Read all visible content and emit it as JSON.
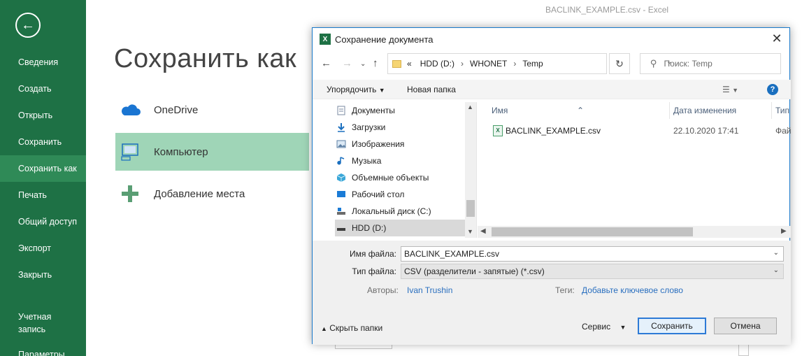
{
  "window": {
    "title": "BACLINK_EXAMPLE.csv  -  Excel"
  },
  "sidebar": {
    "back_icon": "back-arrow-icon",
    "items": [
      {
        "label": "Сведения"
      },
      {
        "label": "Создать"
      },
      {
        "label": "Открыть"
      },
      {
        "label": "Сохранить"
      },
      {
        "label": "Сохранить как",
        "active": true
      },
      {
        "label": "Печать"
      },
      {
        "label": "Общий доступ"
      },
      {
        "label": "Экспорт"
      },
      {
        "label": "Закрыть"
      },
      {
        "label": "Учетная запись"
      },
      {
        "label": "Параметры"
      }
    ],
    "bg_color": "#1e7145"
  },
  "main": {
    "title": "Сохранить как",
    "locations": [
      {
        "label": "OneDrive",
        "icon": "cloud-icon"
      },
      {
        "label": "Компьютер",
        "icon": "computer-icon",
        "selected": true
      },
      {
        "label": "Добавление места",
        "icon": "plus-icon"
      }
    ]
  },
  "dialog": {
    "title": "Сохранение документа",
    "breadcrumb": {
      "prefix": "«",
      "parts": [
        "HDD (D:)",
        "WHONET",
        "Temp"
      ]
    },
    "search_placeholder": "Поиск: Temp",
    "toolbar": {
      "organize": "Упорядочить",
      "new_folder": "Новая папка"
    },
    "tree": [
      {
        "label": "Документы",
        "icon": "documents-icon"
      },
      {
        "label": "Загрузки",
        "icon": "downloads-icon"
      },
      {
        "label": "Изображения",
        "icon": "pictures-icon"
      },
      {
        "label": "Музыка",
        "icon": "music-icon"
      },
      {
        "label": "Объемные объекты",
        "icon": "3d-objects-icon"
      },
      {
        "label": "Рабочий стол",
        "icon": "desktop-icon"
      },
      {
        "label": "Локальный диск (C:)",
        "icon": "drive-icon"
      },
      {
        "label": "HDD (D:)",
        "icon": "drive-icon",
        "selected": true
      }
    ],
    "columns": {
      "name": "Имя",
      "date": "Дата изменения",
      "type": "Тип"
    },
    "files": [
      {
        "name": "BACLINK_EXAMPLE.csv",
        "date": "22.10.2020 17:41",
        "type": "Фай"
      }
    ],
    "filename_label": "Имя файла:",
    "filename_value": "BACLINK_EXAMPLE.csv",
    "filetype_label": "Тип файла:",
    "filetype_value": "CSV (разделители - запятые) (*.csv)",
    "authors_label": "Авторы:",
    "authors_value": "Ivan Trushin",
    "tags_label": "Теги:",
    "tags_value": "Добавьте ключевое слово",
    "hide_folders": "Скрыть папки",
    "service": "Сервис",
    "save": "Сохранить",
    "cancel": "Отмена",
    "accent_color": "#1979ca"
  }
}
